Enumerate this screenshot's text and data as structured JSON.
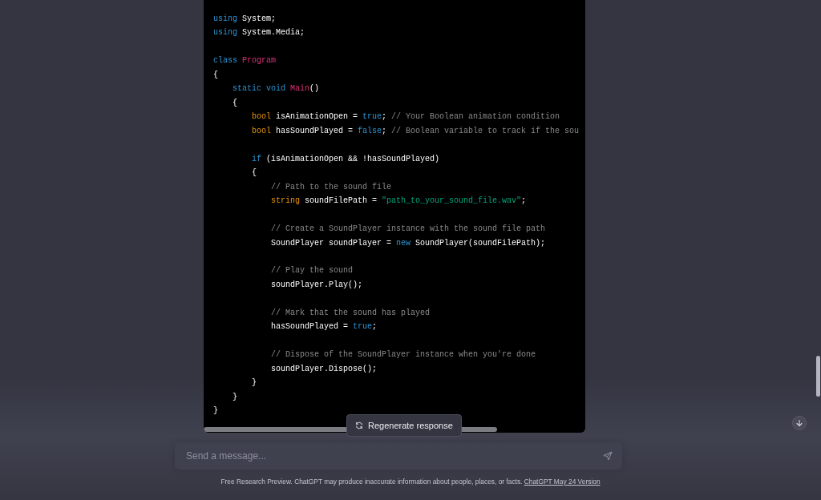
{
  "code_block": {
    "lines": [
      {
        "kind": "code",
        "tokens": [
          {
            "kind": "keyword",
            "text": "using"
          },
          {
            "kind": "plain",
            "text": " System;"
          }
        ]
      },
      {
        "kind": "code",
        "tokens": [
          {
            "kind": "keyword",
            "text": "using"
          },
          {
            "kind": "plain",
            "text": " System.Media;"
          }
        ]
      },
      {
        "kind": "blank"
      },
      {
        "kind": "code",
        "tokens": [
          {
            "kind": "keyword",
            "text": "class"
          },
          {
            "kind": "name",
            "text": " Program"
          }
        ]
      },
      {
        "kind": "code",
        "tokens": [
          {
            "kind": "plain",
            "text": "{"
          }
        ]
      },
      {
        "kind": "code",
        "tokens": [
          {
            "kind": "keyword",
            "text": "    static void"
          },
          {
            "kind": "name",
            "text": " Main"
          },
          {
            "kind": "plain",
            "text": "()"
          }
        ]
      },
      {
        "kind": "code",
        "tokens": [
          {
            "kind": "plain",
            "text": "    {"
          }
        ]
      },
      {
        "kind": "code",
        "tokens": [
          {
            "kind": "type",
            "text": "        bool"
          },
          {
            "kind": "plain",
            "text": " isAnimationOpen = "
          },
          {
            "kind": "keyword",
            "text": "true"
          },
          {
            "kind": "plain",
            "text": "; "
          },
          {
            "kind": "comment",
            "text": "// Your Boolean animation condition"
          }
        ]
      },
      {
        "kind": "code",
        "tokens": [
          {
            "kind": "type",
            "text": "        bool"
          },
          {
            "kind": "plain",
            "text": " hasSoundPlayed = "
          },
          {
            "kind": "keyword",
            "text": "false"
          },
          {
            "kind": "plain",
            "text": "; "
          },
          {
            "kind": "comment",
            "text": "// Boolean variable to track if the sou"
          }
        ]
      },
      {
        "kind": "blank"
      },
      {
        "kind": "code",
        "tokens": [
          {
            "kind": "keyword",
            "text": "        if"
          },
          {
            "kind": "plain",
            "text": " (isAnimationOpen && !hasSoundPlayed)"
          }
        ]
      },
      {
        "kind": "code",
        "tokens": [
          {
            "kind": "plain",
            "text": "        {"
          }
        ]
      },
      {
        "kind": "code",
        "tokens": [
          {
            "kind": "comment",
            "text": "            // Path to the sound file"
          }
        ]
      },
      {
        "kind": "code",
        "tokens": [
          {
            "kind": "type",
            "text": "            string"
          },
          {
            "kind": "plain",
            "text": " soundFilePath = "
          },
          {
            "kind": "string",
            "text": "\"path_to_your_sound_file.wav\""
          },
          {
            "kind": "plain",
            "text": ";"
          }
        ]
      },
      {
        "kind": "blank"
      },
      {
        "kind": "code",
        "tokens": [
          {
            "kind": "comment",
            "text": "            // Create a SoundPlayer instance with the sound file path"
          }
        ]
      },
      {
        "kind": "code",
        "tokens": [
          {
            "kind": "plain",
            "text": "            SoundPlayer soundPlayer = "
          },
          {
            "kind": "keyword",
            "text": "new"
          },
          {
            "kind": "plain",
            "text": " SoundPlayer(soundFilePath);"
          }
        ]
      },
      {
        "kind": "blank"
      },
      {
        "kind": "code",
        "tokens": [
          {
            "kind": "comment",
            "text": "            // Play the sound"
          }
        ]
      },
      {
        "kind": "code",
        "tokens": [
          {
            "kind": "plain",
            "text": "            soundPlayer.Play();"
          }
        ]
      },
      {
        "kind": "blank"
      },
      {
        "kind": "code",
        "tokens": [
          {
            "kind": "comment",
            "text": "            // Mark that the sound has played"
          }
        ]
      },
      {
        "kind": "code",
        "tokens": [
          {
            "kind": "plain",
            "text": "            hasSoundPlayed = "
          },
          {
            "kind": "keyword",
            "text": "true"
          },
          {
            "kind": "plain",
            "text": ";"
          }
        ]
      },
      {
        "kind": "blank"
      },
      {
        "kind": "code",
        "tokens": [
          {
            "kind": "comment",
            "text": "            // Dispose of the SoundPlayer instance when you're done"
          }
        ]
      },
      {
        "kind": "code",
        "tokens": [
          {
            "kind": "plain",
            "text": "            soundPlayer.Dispose();"
          }
        ]
      },
      {
        "kind": "code",
        "tokens": [
          {
            "kind": "plain",
            "text": "        }"
          }
        ]
      },
      {
        "kind": "code",
        "tokens": [
          {
            "kind": "plain",
            "text": "    }"
          }
        ]
      },
      {
        "kind": "code",
        "tokens": [
          {
            "kind": "plain",
            "text": "}"
          }
        ]
      }
    ]
  },
  "regenerate_button": {
    "label": "Regenerate response"
  },
  "message_input": {
    "placeholder": "Send a message..."
  },
  "footer": {
    "text": "Free Research Preview. ChatGPT may produce inaccurate information about people, places, or facts. ",
    "link": "ChatGPT May 24 Version"
  }
}
